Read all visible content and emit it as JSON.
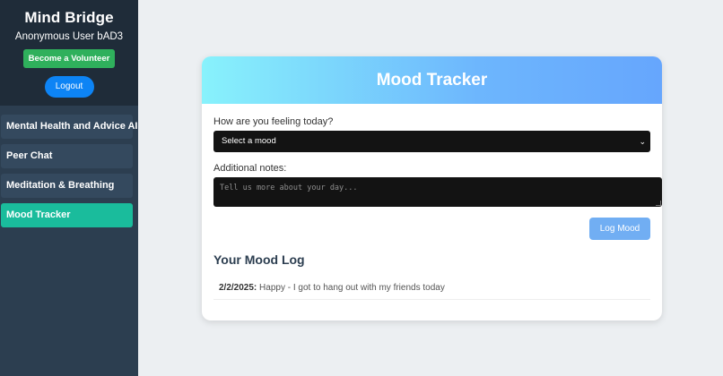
{
  "sidebar": {
    "brand": "Mind Bridge",
    "user": "Anonymous User bAD3",
    "volunteer_label": "Become a Volunteer",
    "logout_label": "Logout",
    "items": [
      {
        "label": "Mental Health and Advice AI",
        "active": false
      },
      {
        "label": "Peer Chat",
        "active": false
      },
      {
        "label": "Meditation & Breathing",
        "active": false
      },
      {
        "label": "Mood Tracker",
        "active": true
      }
    ]
  },
  "main": {
    "title": "Mood Tracker",
    "mood_label": "How are you feeling today?",
    "mood_select_value": "Select a mood",
    "notes_label": "Additional notes:",
    "notes_placeholder": "Tell us more about your day...",
    "log_button": "Log Mood",
    "log_title": "Your Mood Log",
    "log_entries": [
      {
        "date": "2/2/2025:",
        "text": " Happy - I got to hang out with my friends today"
      }
    ]
  },
  "colors": {
    "sidebar_bg": "#2c3e50",
    "active_item": "#1abc9c",
    "volunteer_green": "#2fb05c",
    "logout_blue": "#0d84f5",
    "log_button": "#71aef3"
  }
}
